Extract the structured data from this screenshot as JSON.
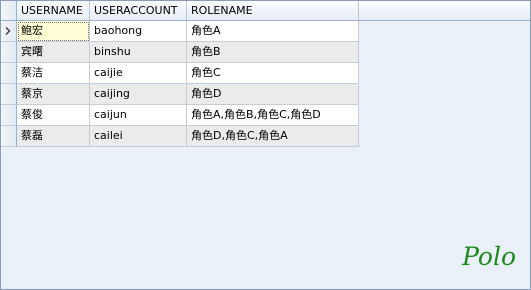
{
  "grid": {
    "columns": [
      "USERNAME",
      "USERACCOUNT",
      "ROLENAME"
    ],
    "rows": [
      {
        "username": "鲍宏",
        "useraccount": "baohong",
        "rolename": "角色A"
      },
      {
        "username": "宾曙",
        "useraccount": "binshu",
        "rolename": "角色B"
      },
      {
        "username": "蔡洁",
        "useraccount": "caijie",
        "rolename": "角色C"
      },
      {
        "username": "蔡京",
        "useraccount": "caijing",
        "rolename": "角色D"
      },
      {
        "username": "蔡俊",
        "useraccount": "caijun",
        "rolename": "角色A,角色B,角色C,角色D"
      },
      {
        "username": "蔡磊",
        "useraccount": "cailei",
        "rolename": "角色D,角色C,角色A"
      }
    ]
  },
  "watermark": "Polo",
  "colors": {
    "header_top": "#fbfcfe",
    "header_bottom": "#e6edf6",
    "row_alt": "#ebebeb",
    "selected_cell": "#fffdd6",
    "background": "#eaf0f8",
    "watermark": "#1f8a1f"
  },
  "icons": {
    "current_row": "right-chevron-icon"
  }
}
